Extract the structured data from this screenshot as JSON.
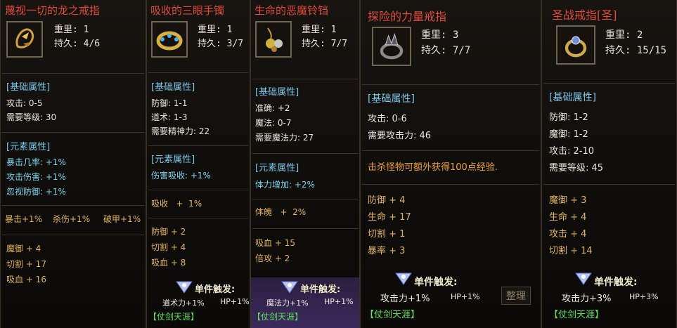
{
  "items": [
    {
      "title": "蔑视一切的龙之戒指",
      "weight": "重里: 1",
      "durability": "持久: 4/6",
      "basic_header": "[基础属性]",
      "basic": [
        "攻击: 0-5",
        "需要等级: 30"
      ],
      "element_header": "[元素属性]",
      "element": [
        "暴击几率: +1%",
        "攻击伤害: +1%",
        "忽视防御: +1%"
      ],
      "extra_row": [
        "暴击+1%",
        "杀伤+1%",
        "破甲+1%"
      ],
      "stats": [
        "魔御 + 4",
        "切割 + 17",
        "吸血 + 16"
      ]
    },
    {
      "title": "吸收的三眼手镯",
      "weight": "重里: 1",
      "durability": "持久: 3/7",
      "basic_header": "[基础属性]",
      "basic": [
        "防御: 1-1",
        "道术: 1-3",
        "需要精神力: 22"
      ],
      "element_header": "[元素属性]",
      "element": [
        "伤害吸收: +1%"
      ],
      "extra_row": [
        "吸收   +  1%"
      ],
      "stats": [
        "防御 + 2",
        "切割 + 4",
        "吸血 + 8"
      ],
      "trigger": "单件触发:",
      "trigger_stats": [
        "道术力+1%",
        "HP+1%"
      ],
      "set_name": "【仗剑天涯】"
    },
    {
      "title": "生命的恶魔铃铛",
      "weight": "重里: 1",
      "durability": "持久: 7/7",
      "basic_header": "[基础属性]",
      "basic": [
        "准确: +2",
        "魔法: 0-7",
        "需要魔法力: 27"
      ],
      "element_header": "[元素属性]",
      "element": [
        "体力增加: +2%"
      ],
      "extra_row": [
        "体魄   +  2%"
      ],
      "stats": [
        "吸血 + 15",
        "倍攻 + 2"
      ],
      "trigger": "单件触发:",
      "trigger_stats": [
        "魔法力+1%",
        "HP+1%"
      ],
      "set_name": "【仗剑天涯】"
    },
    {
      "title": "探险的力量戒指",
      "weight": "重里: 3",
      "durability": "持久: 7/7",
      "basic_header": "[基础属性]",
      "basic": [
        "攻击: 0-6",
        "需要攻击力: 46"
      ],
      "note": "击杀怪物可额外获得100点经验.",
      "stats": [
        "防御 + 4",
        "生命 + 17",
        "切割 + 1",
        "暴率 + 3"
      ],
      "trigger": "单件触发:",
      "trigger_stats": [
        "攻击力+1%",
        "HP+1%"
      ],
      "set_name": "【仗剑天涯】",
      "bg_button": "整理"
    },
    {
      "title": "圣战戒指[圣]",
      "weight": "重里: 2",
      "durability": "持久: 15/15",
      "basic_header": "[基础属性]",
      "basic": [
        "防御: 1-2",
        "魔御: 1-2",
        "攻击: 2-10",
        "需要等级: 45"
      ],
      "stats": [
        "魔御 + 3",
        "生命 + 4",
        "攻击 + 4",
        "切割 + 14"
      ],
      "trigger": "单件触发:",
      "trigger_stats": [
        "攻击力+3%",
        "HP+3%"
      ],
      "set_name": "【仗剑天涯】"
    }
  ],
  "bg_label": "整理"
}
